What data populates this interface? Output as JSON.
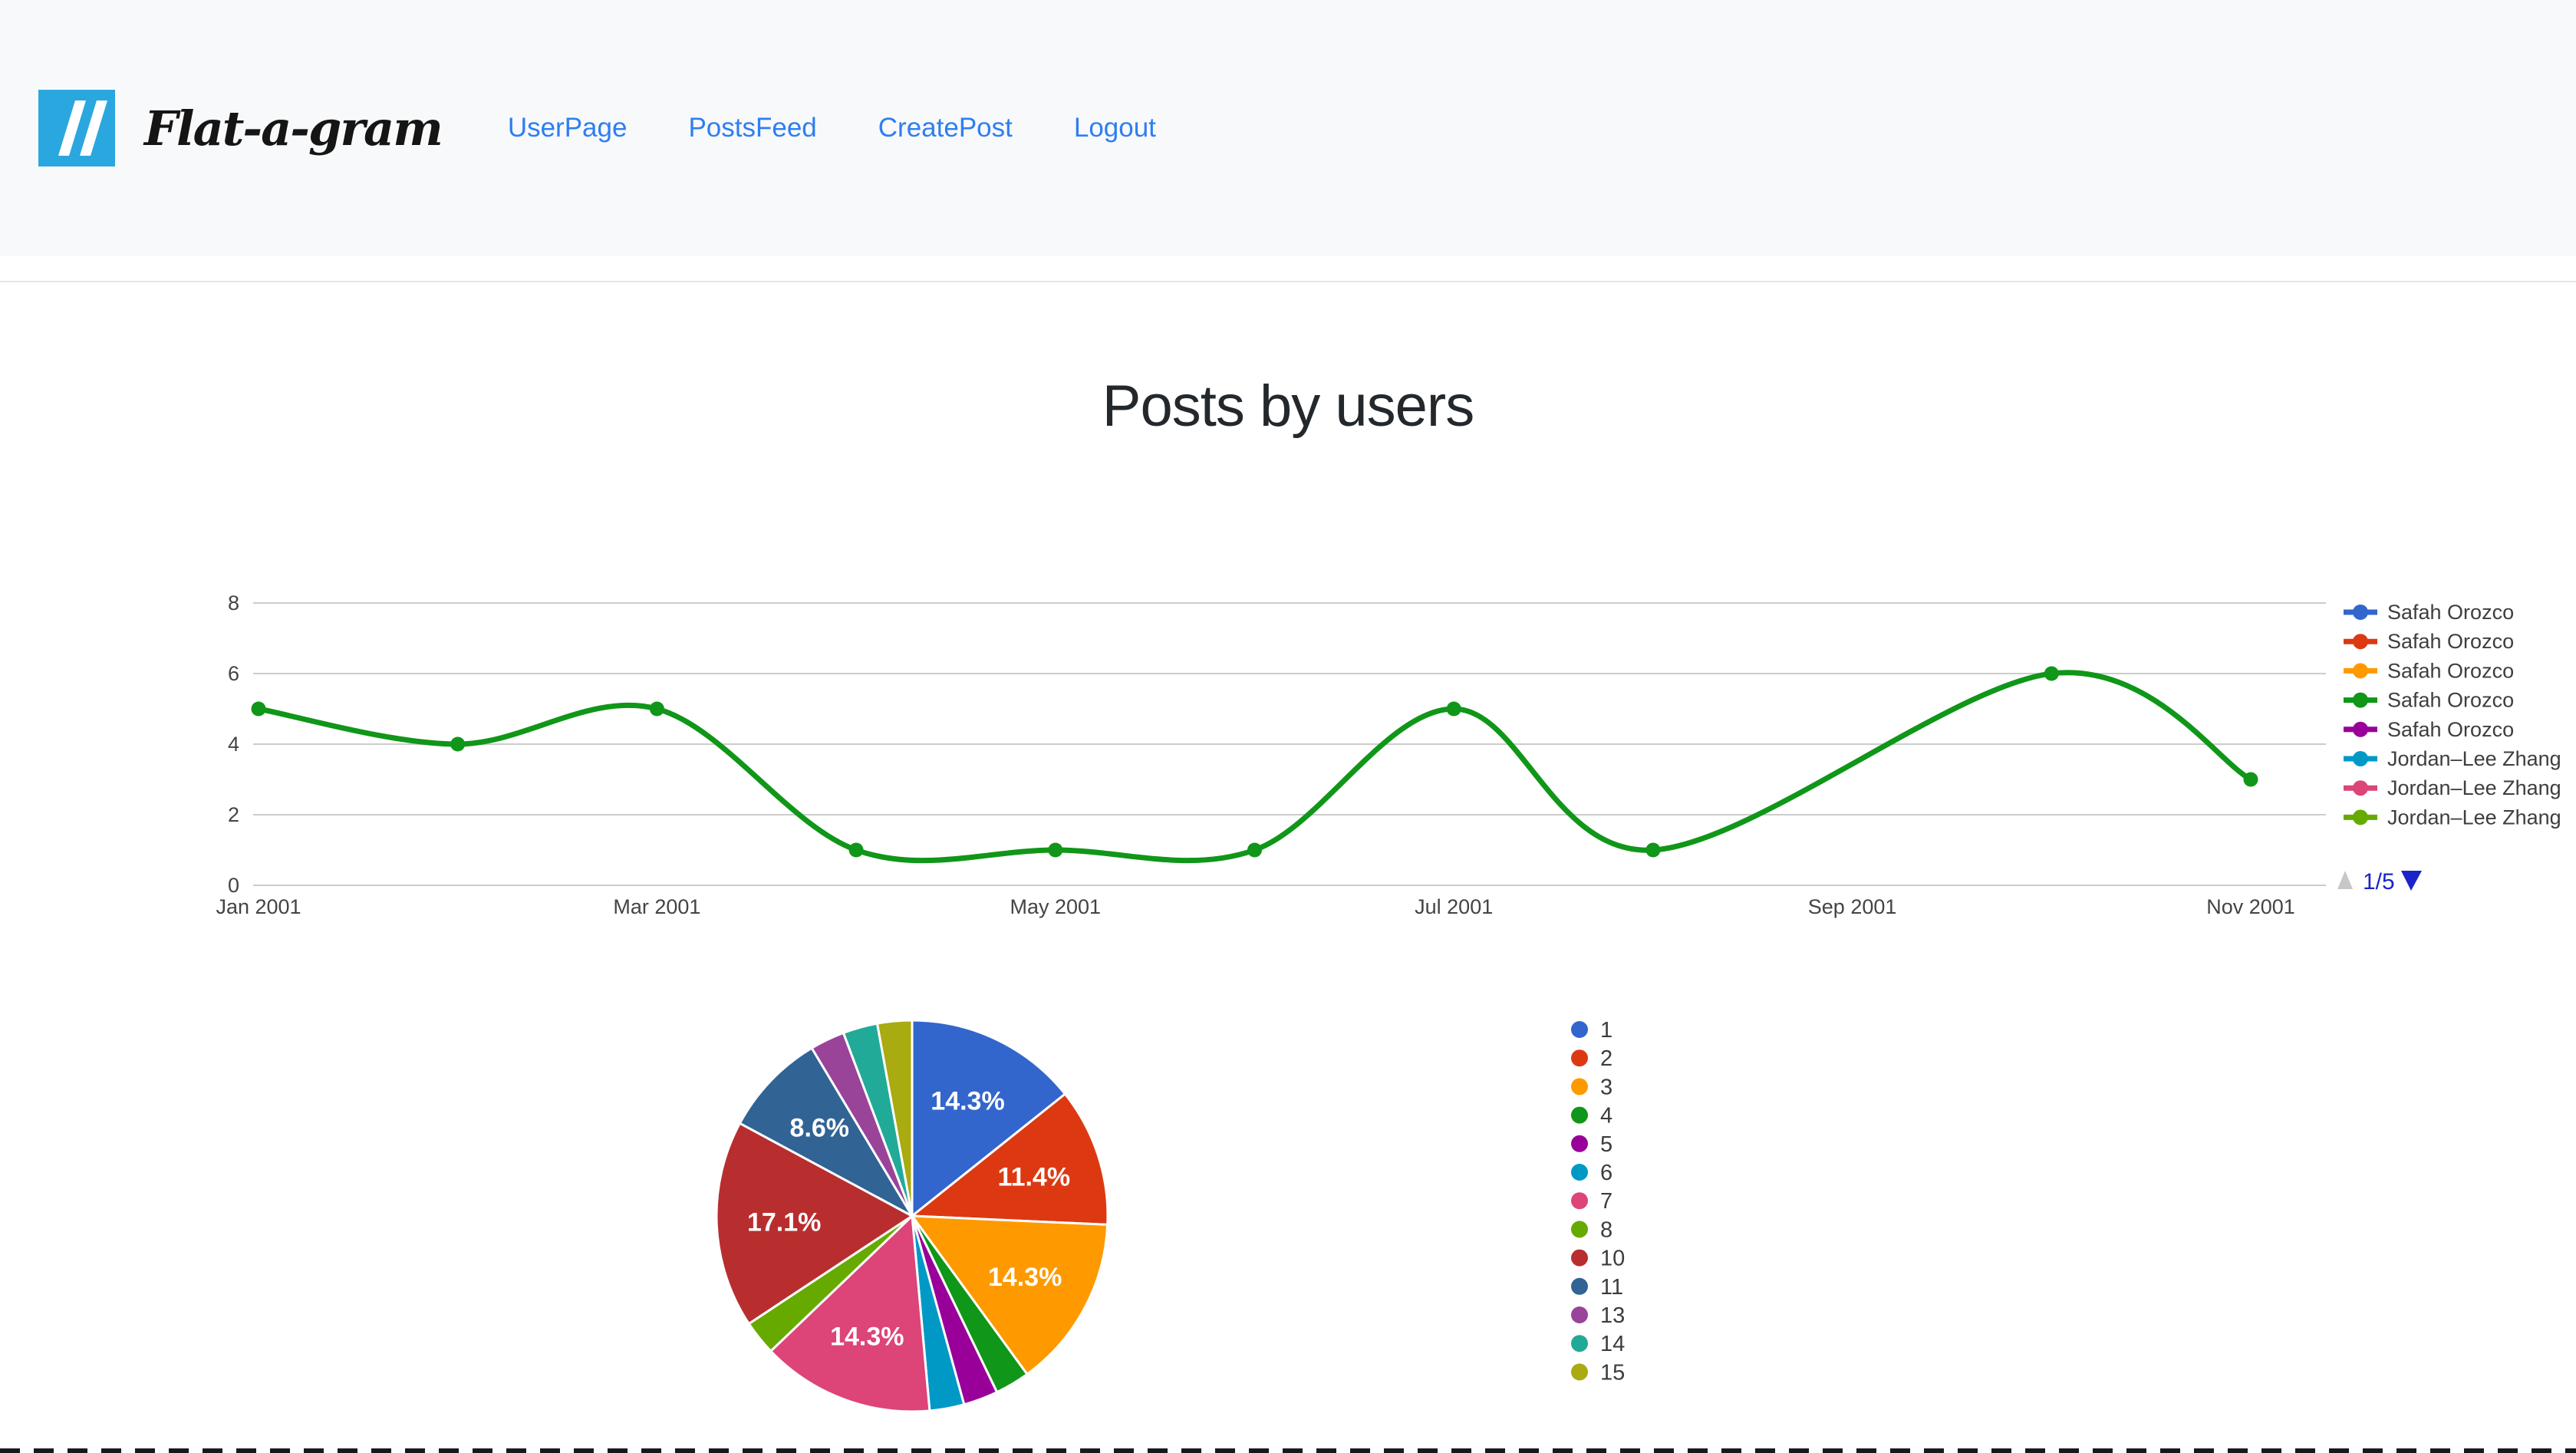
{
  "navbar": {
    "brand": "Flat-a-gram",
    "logo_icon": "double-slash-icon",
    "logo_color": "#2aa7de",
    "link_color": "#2e7ef2",
    "links": [
      {
        "id": "userpage",
        "label": "UserPage"
      },
      {
        "id": "postsfeed",
        "label": "PostsFeed"
      },
      {
        "id": "createpost",
        "label": "CreatePost"
      },
      {
        "id": "logout",
        "label": "Logout"
      }
    ]
  },
  "page": {
    "title": "Posts by users"
  },
  "chart_data": [
    {
      "type": "line",
      "title": "",
      "curve": "function",
      "grid": true,
      "ylim": [
        0,
        8
      ],
      "y_ticks": [
        0,
        2,
        4,
        6,
        8
      ],
      "x_tick_labels": [
        "Jan 2001",
        "Mar 2001",
        "May 2001",
        "Jul 2001",
        "Sep 2001",
        "Nov 2001"
      ],
      "x_tick_month_index": [
        0,
        2,
        4,
        6,
        8,
        10
      ],
      "visible_series_name": "Safah Orozco",
      "visible_series_color": "#109618",
      "points": [
        {
          "month": "Jan 2001",
          "month_index": 0,
          "value": 5
        },
        {
          "month": "Feb 2001",
          "month_index": 1,
          "value": 4
        },
        {
          "month": "Mar 2001",
          "month_index": 2,
          "value": 5
        },
        {
          "month": "Apr 2001",
          "month_index": 3,
          "value": 1
        },
        {
          "month": "May 2001",
          "month_index": 4,
          "value": 1
        },
        {
          "month": "Jun 2001",
          "month_index": 5,
          "value": 1
        },
        {
          "month": "Jul 2001",
          "month_index": 6,
          "value": 5
        },
        {
          "month": "Aug 2001",
          "month_index": 7,
          "value": 1
        },
        {
          "month": "Oct 2001",
          "month_index": 9,
          "value": 6
        },
        {
          "month": "Nov 2001",
          "month_index": 10,
          "value": 3
        }
      ],
      "legend": {
        "position": "right",
        "entries": [
          {
            "label": "Safah Orozco",
            "color": "#3366cc"
          },
          {
            "label": "Safah Orozco",
            "color": "#dc3912"
          },
          {
            "label": "Safah Orozco",
            "color": "#ff9900"
          },
          {
            "label": "Safah Orozco",
            "color": "#109618"
          },
          {
            "label": "Safah Orozco",
            "color": "#990099"
          },
          {
            "label": "Jordan–Lee Zhang",
            "color": "#0099c6"
          },
          {
            "label": "Jordan–Lee Zhang",
            "color": "#dd4477"
          },
          {
            "label": "Jordan–Lee Zhang",
            "color": "#66aa00"
          }
        ],
        "pagination": "1/5",
        "pagination_prev_icon": "legend-prev-icon",
        "pagination_next_icon": "legend-next-icon",
        "pagination_active_color": "#1b24c8",
        "pagination_disabled_color": "#c7c7c7"
      },
      "axis_label_color": "#444444",
      "legend_text_color": "#3e3e3e",
      "gridline_color": "#cccccc"
    },
    {
      "type": "pie",
      "title": "",
      "legend_position": "right",
      "label_color": "#ffffff",
      "slices": [
        {
          "label": "1",
          "value": 5,
          "pct_label": "14.3%",
          "color": "#3366cc"
        },
        {
          "label": "2",
          "value": 4,
          "pct_label": "11.4%",
          "color": "#dc3912"
        },
        {
          "label": "3",
          "value": 5,
          "pct_label": "14.3%",
          "color": "#ff9900"
        },
        {
          "label": "4",
          "value": 1,
          "pct_label": "",
          "color": "#109618"
        },
        {
          "label": "5",
          "value": 1,
          "pct_label": "",
          "color": "#990099"
        },
        {
          "label": "6",
          "value": 1,
          "pct_label": "",
          "color": "#0099c6"
        },
        {
          "label": "7",
          "value": 5,
          "pct_label": "14.3%",
          "color": "#dd4477"
        },
        {
          "label": "8",
          "value": 1,
          "pct_label": "",
          "color": "#66aa00"
        },
        {
          "label": "10",
          "value": 6,
          "pct_label": "17.1%",
          "color": "#b82e2e"
        },
        {
          "label": "11",
          "value": 3,
          "pct_label": "8.6%",
          "color": "#316395"
        },
        {
          "label": "13",
          "value": 1,
          "pct_label": "",
          "color": "#994499"
        },
        {
          "label": "14",
          "value": 1,
          "pct_label": "",
          "color": "#22aa99"
        },
        {
          "label": "15",
          "value": 1,
          "pct_label": "",
          "color": "#aaaa11"
        }
      ]
    }
  ]
}
